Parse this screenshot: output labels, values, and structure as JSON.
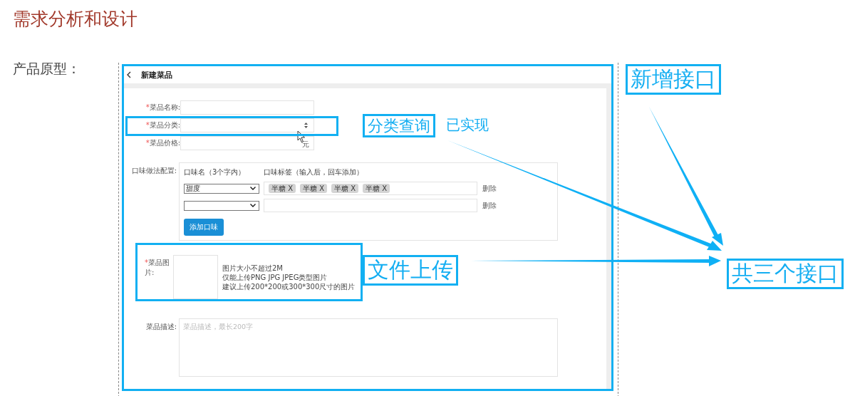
{
  "heading": "需求分析和设计",
  "prototype_label": "产品原型：",
  "mockup": {
    "title": "新建菜品",
    "fields": [
      {
        "kind": "text",
        "label": "菜品名称:",
        "required_mark": "*"
      },
      {
        "kind": "select",
        "label": "菜品分类:",
        "required_mark": "*"
      },
      {
        "kind": "suffix",
        "label": "菜品价格:",
        "required_mark": "*",
        "suffix": "元"
      }
    ],
    "flavor": {
      "label": "口味做法配置:",
      "name_header": "口味名（3个字内）",
      "tags_header": "口味标签（输入后，回车添加）",
      "rows": [
        {
          "value": "甜度",
          "tags": [
            "半糖 X",
            "半糖 X",
            "半糖 X",
            "半糖 X"
          ],
          "delete": "删除"
        },
        {
          "tags": [],
          "delete": "删除"
        }
      ],
      "add_button": "添加口味"
    },
    "image": {
      "label": "菜品图片:",
      "required_mark": "*",
      "hints": [
        "图片大小不超过2M",
        "仅能上传PNG JPG JPEG类型图片",
        "建议上传200*200或300*300尺寸的图片"
      ]
    },
    "description": {
      "label": "菜品描述:",
      "placeholder": "菜品描述，最长200字"
    }
  },
  "annotations": [
    {
      "text": "分类查询",
      "boxed": true
    },
    {
      "text": "已实现",
      "boxed": false
    },
    {
      "text": "新增接口",
      "boxed": true
    },
    {
      "text": "文件上传",
      "boxed": true
    },
    {
      "text": "共三个接口",
      "boxed": true
    }
  ]
}
